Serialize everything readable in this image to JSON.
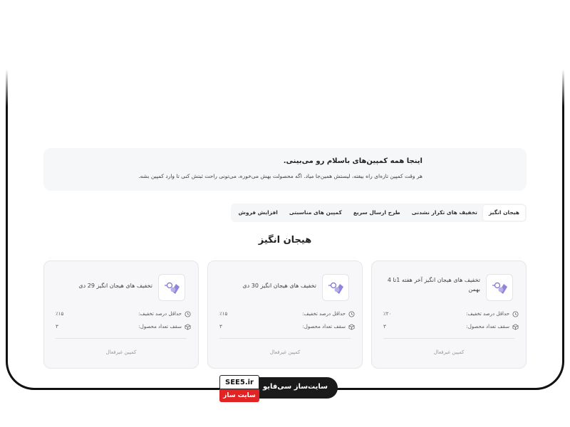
{
  "info": {
    "title": "اینجا همه کمپین‌های باسلام رو می‌بینی.",
    "description": "هر وقت کمپین تازه‌ای راه بیفته، لیستش همین‌جا میاد. اگه محصولت بهش می‌خوره، می‌تونی راحت ثبتش کنی تا وارد کمپین بشه."
  },
  "tabs": [
    {
      "label": "هیجان انگیز",
      "active": true
    },
    {
      "label": "تخفیف های تکرار نشدنی",
      "active": false
    },
    {
      "label": "طرح ارسال سریع",
      "active": false
    },
    {
      "label": "کمپین های مناسبتی",
      "active": false
    },
    {
      "label": "افزایش فروش",
      "active": false
    }
  ],
  "section_title": "هیجان انگیز",
  "labels": {
    "min_discount": "حداقل درصد تخفیف:",
    "max_products": "سقف تعداد محصول:"
  },
  "cards": [
    {
      "title": "تخفیف های هیجان انگیز آخر هفته 1تا 4 بهمن",
      "min_discount": "٪۲۰",
      "max_products": "۳",
      "status": "کمپین غیرفعال"
    },
    {
      "title": "تخفیف های هیجان انگیز 30 دی",
      "min_discount": "٪۱۵",
      "max_products": "۳",
      "status": "کمپین غیرفعال"
    },
    {
      "title": "تخفیف های هیجان انگیز 29 دی",
      "min_discount": "٪۱۵",
      "max_products": "۳",
      "status": "کمپین غیرفعال"
    }
  ],
  "watermark": {
    "badge_text": "سایت‌ساز سی‌فایو",
    "logo_top": "SEE5.ir",
    "logo_bottom": "سایت ساز"
  },
  "colors": {
    "icon_accent": "#7b6fd0",
    "logo_red": "#e02323"
  }
}
